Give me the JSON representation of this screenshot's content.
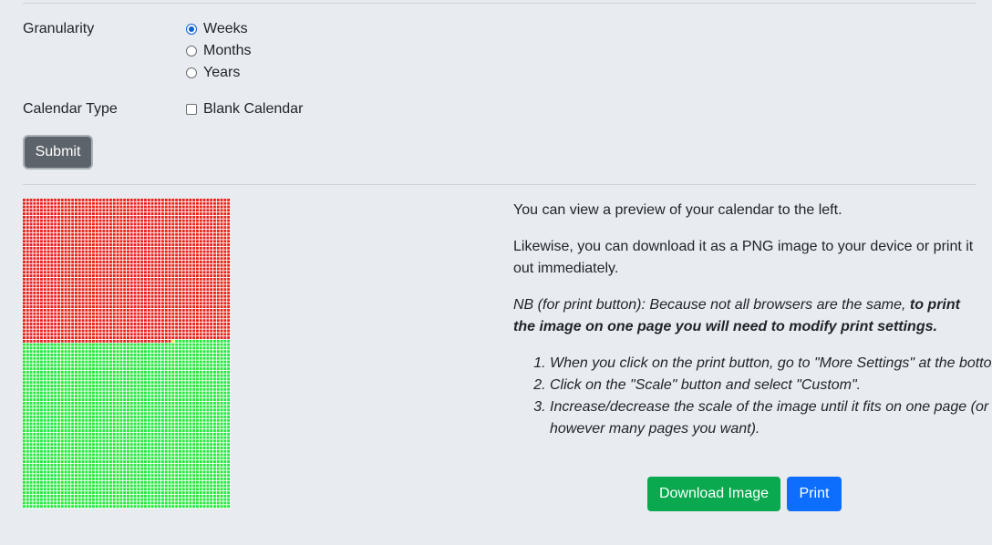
{
  "form": {
    "granularity_label": "Granularity",
    "granularity_options": [
      {
        "label": "Weeks",
        "checked": true
      },
      {
        "label": "Months",
        "checked": false
      },
      {
        "label": "Years",
        "checked": false
      }
    ],
    "calendar_type_label": "Calendar Type",
    "blank_calendar_label": "Blank Calendar",
    "blank_calendar_checked": false,
    "submit_label": "Submit"
  },
  "preview": {
    "colors": {
      "past": "#e8201c",
      "current": "#f2e93b",
      "future": "#22e83a"
    }
  },
  "info": {
    "p1": "You can view a preview of your calendar to the left.",
    "p2": "Likewise, you can download it as a PNG image to your device or print it out immediately.",
    "nb_intro": "NB (for print button): Because not all browsers are the same, ",
    "nb_bold": "to print the image on one page you will need to modify print settings.",
    "steps": [
      "When you click on the print button, go to \"More Settings\" at the bottom.",
      "Click on the \"Scale\" button and select \"Custom\".",
      "Increase/decrease the scale of the image until it fits on one page (or however many pages you want)."
    ]
  },
  "actions": {
    "download_label": "Download Image",
    "print_label": "Print"
  }
}
